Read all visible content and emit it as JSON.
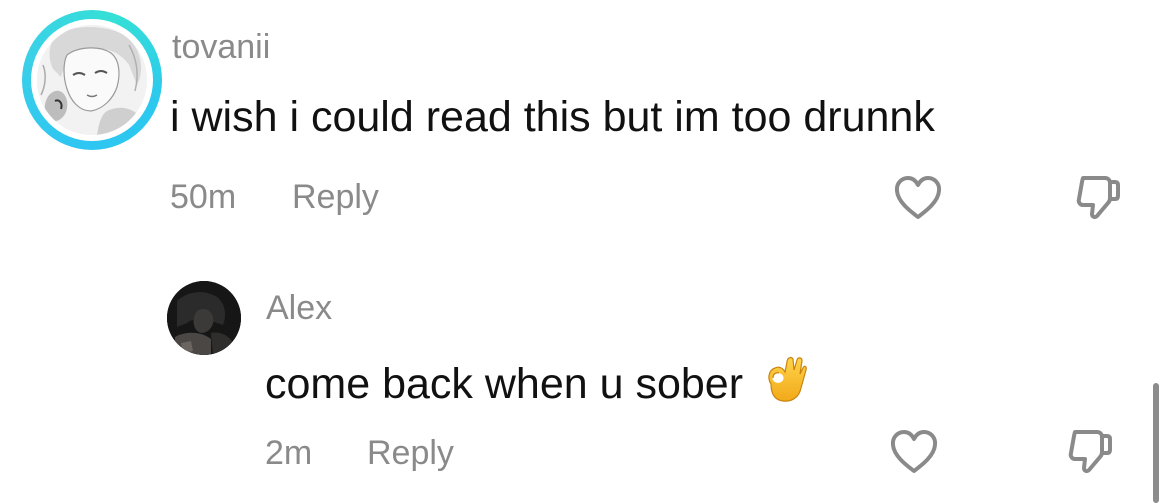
{
  "comments": [
    {
      "username": "tovanii",
      "text": "i wish i could read this but im too drunnk",
      "time": "50m",
      "reply_label": "Reply",
      "avatar_icon": "avatar-icon",
      "ring_color": "#2fc6f2"
    }
  ],
  "replies": [
    {
      "username": "Alex",
      "text": "come back when u sober",
      "emoji": "ok-hand-emoji",
      "time": "2m",
      "reply_label": "Reply",
      "avatar_icon": "avatar-icon"
    }
  ],
  "icons": {
    "like": "heart-icon",
    "dislike": "thumbs-down-icon",
    "color": "#8a8a8a"
  },
  "colors": {
    "username": "#8a8a8a",
    "text": "#111111",
    "background": "#ffffff"
  }
}
